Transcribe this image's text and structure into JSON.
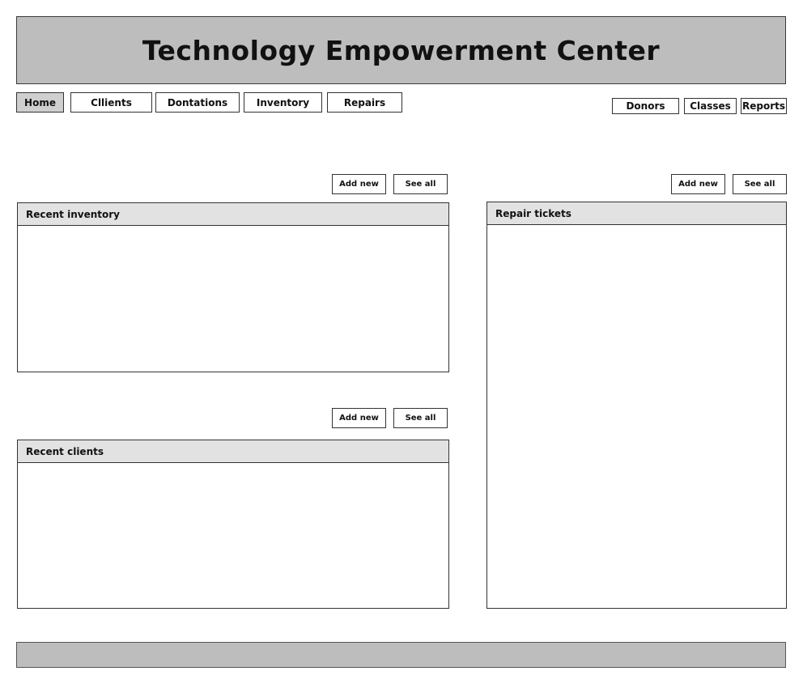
{
  "app": {
    "title": "Technology Empowerment Center"
  },
  "nav": {
    "left": [
      "Home",
      "Cllients",
      "Dontations",
      "Inventory",
      "Repairs"
    ],
    "right": [
      "Donors",
      "Classes",
      "Reports"
    ],
    "active": "Home"
  },
  "panels": {
    "inventory": {
      "title": "Recent inventory",
      "add_label": "Add new",
      "see_all_label": "See all"
    },
    "clients": {
      "title": "Recent clients",
      "add_label": "Add new",
      "see_all_label": "See all"
    },
    "repairs": {
      "title": "Repair tickets",
      "add_label": "Add new",
      "see_all_label": "See all"
    }
  }
}
